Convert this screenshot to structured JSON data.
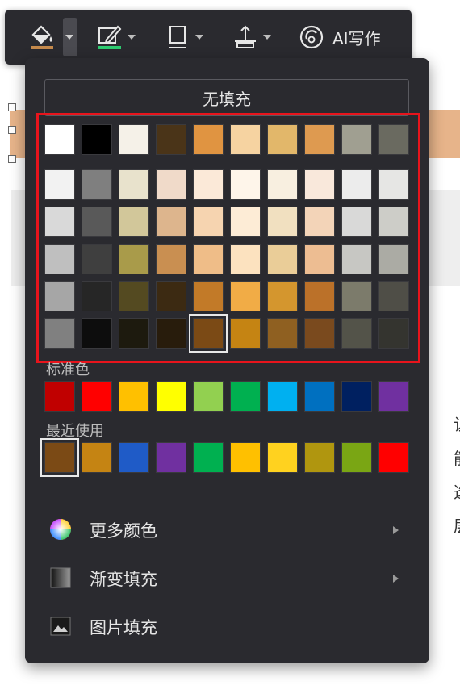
{
  "toolbar": {
    "ai_label": "AI写作",
    "fill_color": "#c58a4c",
    "outline_color": "#2ecc71"
  },
  "popup": {
    "no_fill_label": "无填充",
    "standard_label": "标准色",
    "recent_label": "最近使用",
    "menu": {
      "more_colors": "更多颜色",
      "gradient_fill": "渐变填充",
      "picture_fill": "图片填充"
    }
  },
  "palette": {
    "theme_row": [
      "#ffffff",
      "#000000",
      "#f5f1e8",
      "#4a3418",
      "#e09441",
      "#f6d3a1",
      "#e2b76a",
      "#de9a50",
      "#a09f91",
      "#6a6a60"
    ],
    "tint_rows": [
      [
        "#f2f2f2",
        "#7f7f7f",
        "#e8e2cc",
        "#f0dac9",
        "#fbe9d8",
        "#fef5ea",
        "#f8efe0",
        "#f9e8db",
        "#ececec",
        "#e6e6e4"
      ],
      [
        "#d9d9d9",
        "#595959",
        "#d2c79a",
        "#ddb58d",
        "#f6d4b0",
        "#fdecd6",
        "#f1e0c0",
        "#f3d4b8",
        "#d9d9d8",
        "#cdcdc8"
      ],
      [
        "#bfbfbf",
        "#3f3f3f",
        "#a99b4a",
        "#c98f51",
        "#efbd88",
        "#fce2bf",
        "#eacd98",
        "#edbd92",
        "#c7c7c3",
        "#ababa4"
      ],
      [
        "#a6a6a6",
        "#262626",
        "#544a21",
        "#3c2a12",
        "#c27a28",
        "#f1ac46",
        "#d4962e",
        "#bb7129",
        "#7c7b6b",
        "#4f4e47"
      ],
      [
        "#808080",
        "#0d0d0d",
        "#1d1a0e",
        "#281c0c",
        "#7b4a15",
        "#c58413",
        "#8f6021",
        "#7a4a1e",
        "#535349",
        "#34342f"
      ]
    ],
    "selected_tint": {
      "row": 4,
      "col": 4
    },
    "standard": [
      "#c00000",
      "#ff0000",
      "#ffc000",
      "#ffff00",
      "#92d050",
      "#00b050",
      "#00b0f0",
      "#0070c0",
      "#002060",
      "#7030a0"
    ],
    "recent": [
      "#7b4a15",
      "#c58413",
      "#1f5bc7",
      "#7030a0",
      "#00b050",
      "#ffc000",
      "#ffd21f",
      "#b0960f",
      "#7aa614",
      "#ff0000"
    ]
  },
  "side_text": [
    "让",
    "能",
    "选",
    "层"
  ]
}
